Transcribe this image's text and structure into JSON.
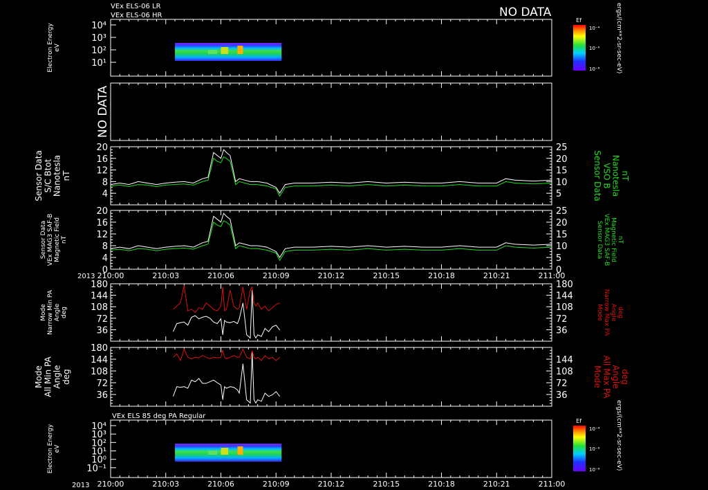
{
  "header": {
    "line1": "VEx ELS-06 LR",
    "line2": "VEx ELS-06 HR",
    "no_data_banner": "NO DATA"
  },
  "colorbar_unit": "ergs/(cm**2-sr-sec-eV)",
  "colors": {
    "white": "#ffffff",
    "green": "#22dd22",
    "red": "#dd1111",
    "frame": "#ffffff",
    "background": "#000000"
  },
  "chart_data": [
    {
      "type": "heatmap",
      "id": "els-spectrogram-top",
      "ylabel": [
        "Electron Energy",
        "eV"
      ],
      "y_ticks": [
        "10⁴",
        "10³",
        "10²",
        "10¹"
      ],
      "y_scale": "log",
      "colorbar": {
        "label": "Ef",
        "ticks": [
          "10⁻⁴",
          "10⁻⁶",
          "10⁻⁸"
        ]
      },
      "data_time_range": [
        "210:03.5",
        "210:09.3"
      ]
    },
    {
      "type": "line",
      "id": "no-data-panel",
      "ylabel": [
        "NO DATA"
      ]
    },
    {
      "type": "line",
      "id": "vso-b-panel",
      "ylabel_left": [
        "Sensor Data",
        "S/C Btot",
        "Nanotesla",
        "nT"
      ],
      "ylabel_right": [
        "Sensor Data",
        "VSO B",
        "Nanotesla",
        "nT"
      ],
      "y_left": {
        "range": [
          0,
          20
        ],
        "ticks": [
          "20",
          "16",
          "12",
          "8",
          "4"
        ]
      },
      "y_right": {
        "range": [
          0,
          25
        ],
        "ticks": [
          "25",
          "20",
          "15",
          "10",
          "5"
        ]
      },
      "series": [
        {
          "name": "S/C Btot",
          "color": "white",
          "x": [
            0,
            0.5,
            1,
            1.5,
            2,
            2.5,
            3,
            3.5,
            4,
            4.5,
            5,
            5.3,
            5.6,
            5.8,
            6,
            6.15,
            6.3,
            6.5,
            6.8,
            7,
            7.3,
            7.6,
            8,
            8.5,
            9,
            9.2,
            9.5,
            10,
            11,
            12,
            13,
            14,
            15,
            16,
            17,
            18,
            19,
            20,
            21,
            21.5,
            22,
            23,
            24
          ],
          "y": [
            7,
            7.5,
            7,
            8,
            7.5,
            7,
            7.5,
            7.8,
            8,
            7.5,
            9,
            9.5,
            18,
            17,
            16,
            19,
            18,
            17,
            8,
            9,
            8.5,
            8,
            8,
            7.5,
            6,
            4,
            7,
            7.5,
            7.5,
            7.8,
            7.5,
            8,
            7.5,
            7.8,
            7.5,
            7.5,
            8,
            7.5,
            7.5,
            9,
            8.5,
            8.2,
            8.5
          ]
        },
        {
          "name": "VSO B",
          "color": "green",
          "x": [
            0,
            0.5,
            1,
            1.5,
            2,
            2.5,
            3,
            3.5,
            4,
            4.5,
            5,
            5.3,
            5.6,
            5.8,
            6,
            6.15,
            6.3,
            6.5,
            6.8,
            7,
            7.3,
            7.6,
            8,
            8.5,
            9,
            9.2,
            9.5,
            10,
            11,
            12,
            13,
            14,
            15,
            16,
            17,
            18,
            19,
            20,
            21,
            21.5,
            22,
            23,
            24
          ],
          "y": [
            6.5,
            6.8,
            6.3,
            7,
            6.8,
            6.3,
            6.8,
            7,
            7.2,
            6.8,
            8,
            8.5,
            16,
            15,
            14.5,
            16.5,
            16,
            15,
            7,
            8,
            7.5,
            7,
            7,
            6.5,
            5.5,
            3,
            6,
            6.5,
            6.5,
            6.8,
            6.5,
            7,
            6.5,
            6.8,
            6.5,
            6.5,
            7,
            6.5,
            6.5,
            8,
            7.5,
            7.2,
            7.5
          ]
        }
      ]
    },
    {
      "type": "line",
      "id": "mag-saf-panel",
      "ylabel_left": [
        "Sensor Data",
        "VEx MAG3 SAF-B",
        "Magnetic Field",
        "nT"
      ],
      "ylabel_right": [
        "Sensor Data",
        "VEx MAG3 SAF-B",
        "Magnetic Field",
        "nT"
      ],
      "y_left": {
        "range": [
          0,
          20
        ],
        "ticks": [
          "20",
          "16",
          "12",
          "8",
          "4",
          "0"
        ]
      },
      "y_right": {
        "range": [
          0,
          25
        ],
        "ticks": [
          "25",
          "20",
          "15",
          "10",
          "5",
          "0"
        ]
      },
      "series": [
        {
          "name": "MAG3 SAF-B",
          "color": "white",
          "x": [
            0,
            0.5,
            1,
            1.5,
            2,
            2.5,
            3,
            3.5,
            4,
            4.5,
            5,
            5.3,
            5.6,
            5.8,
            6,
            6.15,
            6.3,
            6.5,
            6.8,
            7,
            7.3,
            7.6,
            8,
            8.5,
            9,
            9.2,
            9.5,
            10,
            11,
            12,
            13,
            14,
            15,
            16,
            17,
            18,
            19,
            20,
            21,
            21.5,
            22,
            23,
            24
          ],
          "y": [
            7,
            7.5,
            7,
            8,
            7.5,
            7,
            7.5,
            7.8,
            8,
            7.5,
            9,
            9.5,
            18,
            17,
            16,
            19,
            18,
            17,
            8,
            9,
            8.5,
            8,
            8,
            7.5,
            6,
            4,
            7,
            7.5,
            7.5,
            7.8,
            7.5,
            8,
            7.5,
            7.8,
            7.5,
            7.5,
            8,
            7.5,
            7.5,
            9,
            8.5,
            8.2,
            8.5
          ]
        },
        {
          "name": "MAG3 SAF-B (green)",
          "color": "green",
          "x": [
            0,
            0.5,
            1,
            1.5,
            2,
            2.5,
            3,
            3.5,
            4,
            4.5,
            5,
            5.3,
            5.6,
            5.8,
            6,
            6.15,
            6.3,
            6.5,
            6.8,
            7,
            7.3,
            7.6,
            8,
            8.5,
            9,
            9.2,
            9.5,
            10,
            11,
            12,
            13,
            14,
            15,
            16,
            17,
            18,
            19,
            20,
            21,
            21.5,
            22,
            23,
            24
          ],
          "y": [
            6.5,
            6.8,
            6.3,
            7,
            6.8,
            6.3,
            6.8,
            7,
            7.2,
            6.8,
            8,
            8.5,
            16,
            15,
            14.5,
            16.5,
            16,
            15,
            7,
            8,
            7.5,
            7,
            7,
            6.5,
            5.5,
            3,
            6,
            6.5,
            6.5,
            6.8,
            6.5,
            7,
            6.5,
            6.8,
            6.5,
            6.5,
            7,
            6.5,
            6.5,
            8,
            7.5,
            7.2,
            7.5
          ]
        }
      ]
    },
    {
      "type": "line",
      "id": "narrow-pa-panel",
      "ylabel_left": [
        "Mode",
        "Narrow Min PA",
        "Angle",
        "deg"
      ],
      "ylabel_right": [
        "Mode",
        "Narrow Max PA",
        "Angle",
        "deg"
      ],
      "y_left": {
        "range": [
          0,
          180
        ],
        "ticks": [
          "180",
          "144",
          "108",
          "72",
          "36"
        ]
      },
      "y_right": {
        "range": [
          0,
          180
        ],
        "ticks": [
          "180",
          "144",
          "108",
          "72",
          "36"
        ]
      },
      "series": [
        {
          "name": "Min PA",
          "color": "white",
          "x": [
            3.4,
            3.6,
            3.8,
            4.0,
            4.2,
            4.4,
            4.6,
            4.8,
            5.0,
            5.2,
            5.4,
            5.6,
            5.8,
            6.0,
            6.1,
            6.2,
            6.3,
            6.5,
            6.7,
            6.9,
            7.0,
            7.2,
            7.4,
            7.6,
            7.7,
            7.8,
            7.9,
            8.0,
            8.2,
            8.4,
            8.6,
            8.8,
            9.0,
            9.2
          ],
          "y": [
            30,
            55,
            58,
            60,
            50,
            75,
            80,
            70,
            75,
            78,
            72,
            60,
            55,
            70,
            20,
            65,
            60,
            58,
            62,
            55,
            70,
            120,
            20,
            10,
            160,
            20,
            10,
            20,
            15,
            40,
            30,
            45,
            50,
            35
          ]
        },
        {
          "name": "Max PA",
          "color": "red",
          "x": [
            3.4,
            3.6,
            3.8,
            4.0,
            4.2,
            4.4,
            4.6,
            4.8,
            5.0,
            5.2,
            5.4,
            5.6,
            5.8,
            6.0,
            6.1,
            6.2,
            6.3,
            6.5,
            6.7,
            6.9,
            7.0,
            7.2,
            7.4,
            7.6,
            7.7,
            7.8,
            7.9,
            8.0,
            8.2,
            8.4,
            8.6,
            8.8,
            9.0,
            9.2
          ],
          "y": [
            100,
            110,
            120,
            175,
            95,
            100,
            90,
            105,
            100,
            120,
            110,
            100,
            95,
            110,
            170,
            95,
            100,
            160,
            110,
            100,
            105,
            170,
            100,
            160,
            170,
            120,
            110,
            120,
            100,
            110,
            95,
            105,
            115,
            120
          ]
        }
      ]
    },
    {
      "type": "line",
      "id": "all-pa-panel",
      "ylabel_left": [
        "Mode",
        "All Min PA",
        "Angle",
        "deg"
      ],
      "ylabel_right": [
        "Mode",
        "All Max PA",
        "Angle",
        "deg"
      ],
      "y_left": {
        "range": [
          0,
          180
        ],
        "ticks": [
          "180",
          "144",
          "108",
          "72",
          "36"
        ]
      },
      "y_right": {
        "range": [
          0,
          180
        ],
        "ticks": [
          "144",
          "108",
          "72",
          "36"
        ]
      },
      "series": [
        {
          "name": "Min PA",
          "color": "white",
          "x": [
            3.4,
            3.6,
            3.8,
            4.0,
            4.2,
            4.4,
            4.6,
            4.8,
            5.0,
            5.2,
            5.4,
            5.6,
            5.8,
            6.0,
            6.1,
            6.2,
            6.3,
            6.5,
            6.7,
            6.9,
            7.0,
            7.2,
            7.4,
            7.6,
            7.7,
            7.8,
            7.9,
            8.0,
            8.2,
            8.4,
            8.6,
            8.8,
            9.0,
            9.2
          ],
          "y": [
            30,
            60,
            58,
            60,
            55,
            80,
            75,
            85,
            70,
            70,
            75,
            80,
            72,
            65,
            20,
            60,
            55,
            60,
            58,
            50,
            40,
            130,
            20,
            10,
            165,
            20,
            10,
            20,
            15,
            40,
            30,
            35,
            45,
            30
          ]
        },
        {
          "name": "Max PA",
          "color": "red",
          "x": [
            3.4,
            3.6,
            3.8,
            4.0,
            4.2,
            4.4,
            4.6,
            4.8,
            5.0,
            5.2,
            5.4,
            5.6,
            5.8,
            6.0,
            6.1,
            6.2,
            6.3,
            6.5,
            6.7,
            6.9,
            7.0,
            7.2,
            7.4,
            7.6,
            7.7,
            7.8,
            7.9,
            8.0,
            8.2,
            8.4,
            8.6,
            8.8,
            9.0,
            9.2
          ],
          "y": [
            150,
            160,
            140,
            175,
            150,
            145,
            150,
            148,
            155,
            150,
            145,
            150,
            148,
            150,
            172,
            150,
            145,
            150,
            155,
            150,
            150,
            175,
            150,
            145,
            170,
            150,
            145,
            150,
            140,
            155,
            145,
            150,
            140,
            150
          ]
        }
      ]
    },
    {
      "type": "heatmap",
      "id": "els-spectrogram-bottom",
      "title": "VEx ELS 85 deg PA Regular",
      "ylabel": [
        "Electron Energy",
        "eV"
      ],
      "y_ticks": [
        "10⁴",
        "10³",
        "10²",
        "10¹",
        "10⁰",
        "10⁻¹"
      ],
      "y_scale": "log",
      "colorbar": {
        "label": "Ef",
        "ticks": [
          "10⁻⁴",
          "10⁻⁶",
          "10⁻⁸"
        ]
      },
      "data_time_range": [
        "210:03.5",
        "210:09.3"
      ]
    }
  ],
  "time_axis": {
    "year_label": "2013",
    "range_minutes": [
      0,
      24
    ],
    "ticks": [
      "210:00",
      "210:03",
      "210:06",
      "210:09",
      "210:12",
      "210:15",
      "210:18",
      "210:21",
      "211:00"
    ]
  }
}
